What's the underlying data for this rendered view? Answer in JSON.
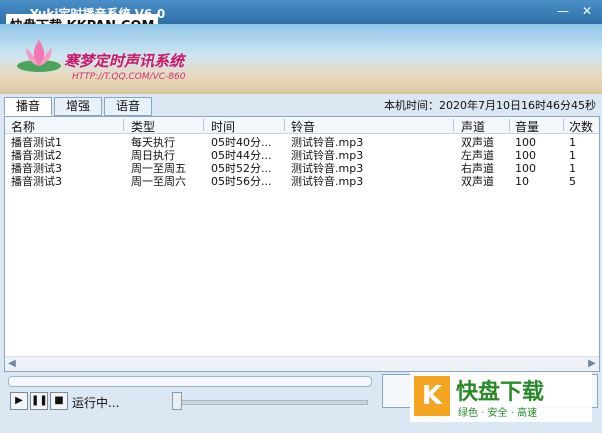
{
  "window": {
    "title": "Yuki定时播音系统 V6.0",
    "minimize": "—",
    "close": "✕"
  },
  "watermark_top": "快盘下载 KKPAN.COM",
  "banner": {
    "name": "寒梦定时声讯系统",
    "url": "HTTP://T.QQ.COM/VC-860"
  },
  "tabs": [
    "播音",
    "增强",
    "语音"
  ],
  "active_tab": 0,
  "clock": "本机时间：2020年7月10日16时46分45秒",
  "columns": [
    "名称",
    "类型",
    "时间",
    "铃音",
    "声道",
    "音量",
    "次数"
  ],
  "rows": [
    [
      "播音测试1",
      "每天执行",
      "05时40分...",
      "测试铃音.mp3",
      "双声道",
      "100",
      "1"
    ],
    [
      "播音测试2",
      "周日执行",
      "05时44分...",
      "测试铃音.mp3",
      "左声道",
      "100",
      "1"
    ],
    [
      "播音测试3",
      "周一至周五",
      "05时52分...",
      "测试铃音.mp3",
      "右声道",
      "100",
      "1"
    ],
    [
      "播音测试3",
      "周一至周六",
      "05时56分...",
      "测试铃音.mp3",
      "双声道",
      "10",
      "5"
    ]
  ],
  "player": {
    "play": "▶",
    "pause": "❚❚",
    "stop": "■",
    "status": "运行中...",
    "progress": 0.0
  },
  "watermark_logo": {
    "k": "K",
    "big": "快盘下载",
    "small": "绿色 · 安全 · 高速"
  }
}
